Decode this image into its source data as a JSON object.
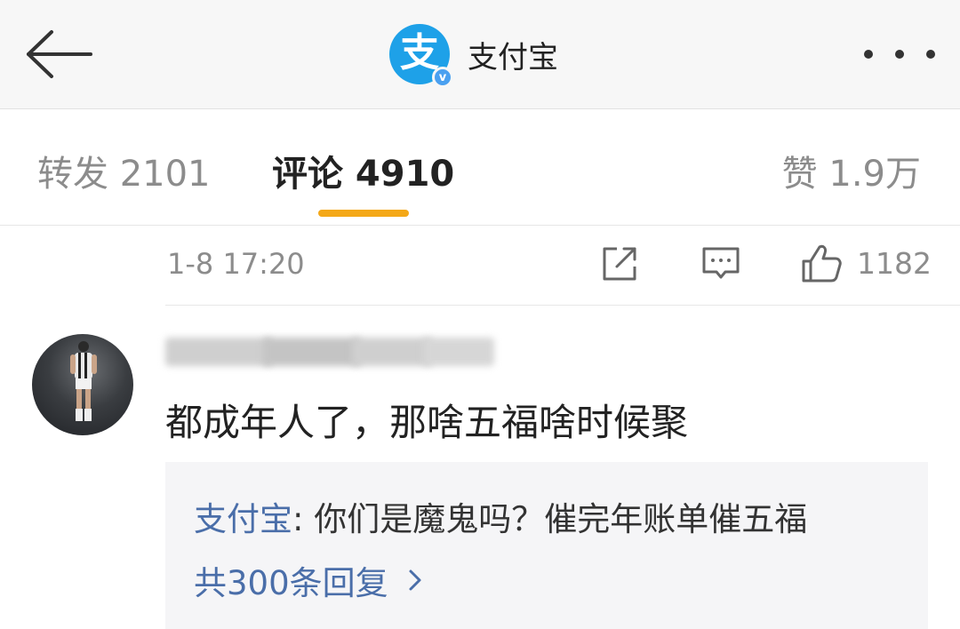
{
  "header": {
    "title": "支付宝",
    "logo_glyph": "支",
    "verified_mark": "v",
    "back_icon": "arrow-left-icon",
    "more_icon": "more-dots-icon"
  },
  "tabs": [
    {
      "label": "转发 2101",
      "active": false
    },
    {
      "label": "评论 4910",
      "active": true
    },
    {
      "label": "赞 1.9万",
      "active": false
    }
  ],
  "post_meta": {
    "time": "1-8 17:20",
    "like_count": "1182",
    "icons": [
      "share-icon",
      "comment-icon",
      "thumb-up-icon"
    ]
  },
  "comment": {
    "text": "都成年人了，那啥五福啥时候聚",
    "reply": {
      "author": "支付宝",
      "separator": ": ",
      "text": "你们是魔鬼吗？催完年账单催五福",
      "more_label": "共300条回复"
    }
  },
  "colors": {
    "accent": "#f4a818",
    "link": "#4a6ea9",
    "logo": "#1ea1e8",
    "muted": "#8c8c8c"
  }
}
